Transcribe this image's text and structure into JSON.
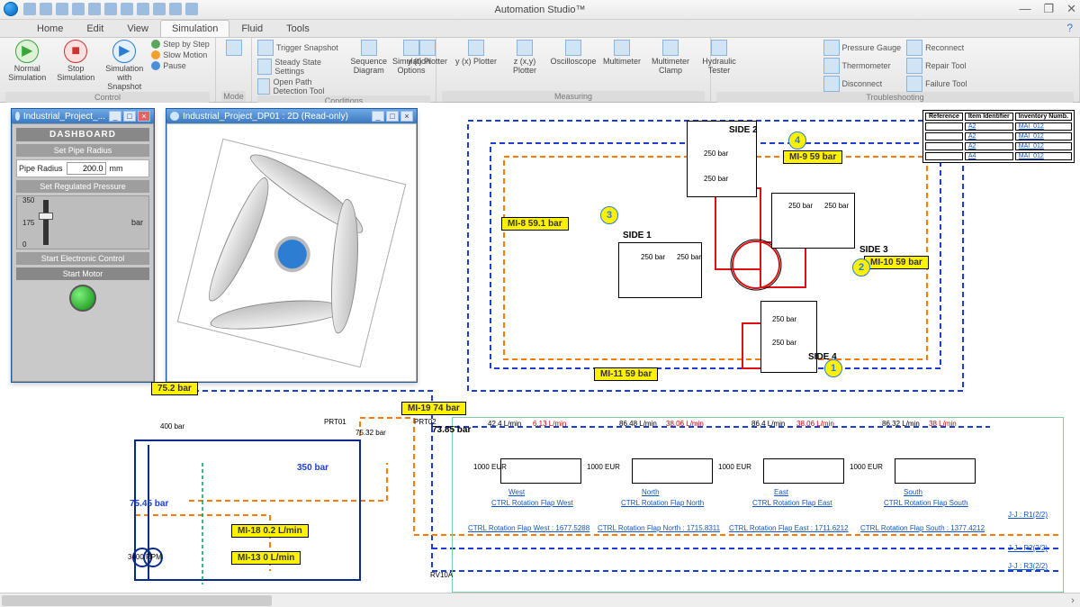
{
  "app": {
    "title": "Automation Studio™"
  },
  "window_controls": {
    "min": "—",
    "max": "❐",
    "close": "✕"
  },
  "tabs": [
    "Home",
    "Edit",
    "View",
    "Simulation",
    "Fluid",
    "Tools"
  ],
  "active_tab": "Simulation",
  "ribbon": {
    "groups": {
      "control": {
        "label": "Control",
        "normal": "Normal Simulation",
        "stop": "Stop Simulation",
        "snapshot": "Simulation with Snapshot",
        "step": "Step by Step",
        "slow": "Slow Motion",
        "pause": "Pause"
      },
      "mode": {
        "label": "Mode"
      },
      "conditions": {
        "label": "Conditions",
        "trigger": "Trigger Snapshot",
        "steady": "Steady State Settings",
        "openpath": "Open Path Detection Tool",
        "seqdiag": "Sequence Diagram",
        "simopt": "Simulation Options"
      },
      "measuring": {
        "label": "Measuring",
        "yt": "y (t) Plotter",
        "yx": "y (x) Plotter",
        "zxy": "z (x,y) Plotter",
        "osc": "Oscilloscope",
        "multi": "Multimeter",
        "clamp": "Multimeter Clamp",
        "hydt": "Hydraulic Tester"
      },
      "troubleshooting": {
        "label": "Troubleshooting",
        "pgauge": "Pressure Gauge",
        "thermo": "Thermometer",
        "disc": "Disconnect",
        "reconn": "Reconnect",
        "repair": "Repair Tool",
        "fail": "Failure Tool"
      }
    }
  },
  "subwindows": {
    "dashboard": {
      "tab": "Industrial_Project_...",
      "title": "DASHBOARD",
      "set_pipe_radius": "Set Pipe Radius",
      "pipe_radius_label": "Pipe Radius",
      "pipe_radius_value": "200.0",
      "pipe_radius_unit": "mm",
      "set_reg_pressure": "Set Regulated Pressure",
      "scale": [
        "350",
        "175",
        "0"
      ],
      "pressure_unit": "bar",
      "start_ec": "Start Electronic Control",
      "start_motor": "Start Motor"
    },
    "view3d": {
      "tab": "Industrial_Project_DP01 : 2D (Read-only)"
    }
  },
  "tags": {
    "t1": "75.2 bar",
    "mi8": "MI-8      59.1 bar",
    "mi9": "MI-9       59 bar",
    "mi10": "MI-10      59 bar",
    "mi11": "MI-11      59 bar",
    "mi18": "MI-18     0.2 L/min",
    "mi13": "MI-13      0 L/min",
    "mi19": "MI-19      74 bar",
    "p7385": "73.85 bar",
    "b350": "350 bar",
    "b7545": "75.45 bar",
    "b400": "400 bar",
    "b250_1": "250 bar",
    "b250_2": "250 bar",
    "b250_3": "250 bar",
    "b250_4": "250 bar",
    "b250_5": "250 bar",
    "b250_6": "250 bar",
    "b250_7": "250 bar",
    "b250_8": "250 bar",
    "prt01": "PRT01",
    "prt02": "PRT02",
    "p7532": "75.32 bar",
    "rpm": "3400 RPM",
    "rv10a": "RV10A"
  },
  "sides": {
    "s1": "SIDE 1",
    "s2": "SIDE 2",
    "s3": "SIDE 3",
    "s4": "SIDE 4"
  },
  "nodes": {
    "n1": "1",
    "n2": "2",
    "n3": "3",
    "n4": "4"
  },
  "flows": {
    "f1": "42.4 L/min",
    "f2": "6.13 L/min",
    "f3": "86.48 L/min",
    "f4": "38.06 L/min",
    "f5": "86.4 L/min",
    "f6": "38.06 L/min",
    "f7": "86.32 L/min",
    "f8": "38 L/min",
    "eur": "1000 EUR"
  },
  "links": {
    "west": "West",
    "north": "North",
    "east": "East",
    "south": "South",
    "cw": "CTRL Rotation Flap West",
    "cn": "CTRL Rotation Flap North",
    "ce": "CTRL Rotation Flap East",
    "cs": "CTRL Rotation Flap South",
    "rw": "CTRL Rotation Flap West : 1677.5288",
    "rn": "CTRL Rotation Flap North : 1715.8311",
    "re": "CTRL Rotation Flap East : 1711.6212",
    "rs": "CTRL Rotation Flap South : 1377.4212",
    "r1": "J-J : R1(2/2)",
    "r2": "J-J : R2(2/2)",
    "r3": "J-J : R3(2/2)"
  },
  "table": {
    "h1": "Reference",
    "h2": "Item Identifier",
    "h3": "Inventory Numb.",
    "rows": [
      [
        "",
        "A2",
        "MAI_012"
      ],
      [
        "",
        "A2",
        "MAI_012"
      ],
      [
        "",
        "A2",
        "MAI_012"
      ],
      [
        "",
        "A4",
        "MAI_012"
      ]
    ]
  }
}
